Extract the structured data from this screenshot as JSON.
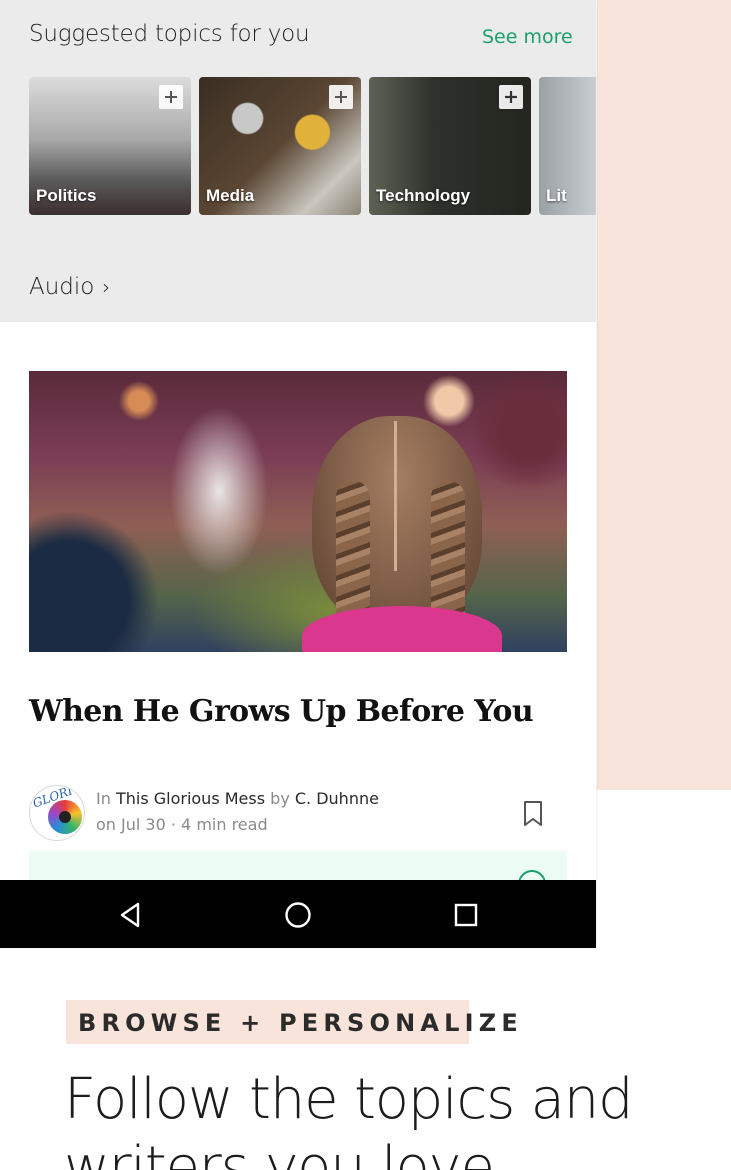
{
  "suggested": {
    "title": "Suggested topics for you",
    "see_more": "See more",
    "topics": [
      {
        "label": "Politics"
      },
      {
        "label": "Media"
      },
      {
        "label": "Technology"
      },
      {
        "label": "Lit"
      }
    ]
  },
  "audio": {
    "label": "Audio",
    "chevron": "›"
  },
  "article": {
    "title": "When He Grows Up Before You",
    "in_prefix": "In",
    "publication": "This Glorious Mess",
    "by_prefix": "by",
    "author": "C. Duhnne",
    "date": "on Jul 30",
    "separator": "·",
    "read_time": "4 min read",
    "publication_logo_text": "GLORI"
  },
  "promo": {
    "badge": "BROWSE + PERSONALIZE",
    "headline": "Follow the topics and writers you love"
  },
  "colors": {
    "accent_green": "#1aa06d",
    "peach": "#f8e4da",
    "section_gray": "#ebebeb"
  },
  "icons": {
    "topic_add": "plus-icon",
    "bookmark": "bookmark-icon",
    "nav_back": "back-triangle-icon",
    "nav_home": "home-circle-icon",
    "nav_recent": "recent-apps-square-icon"
  }
}
